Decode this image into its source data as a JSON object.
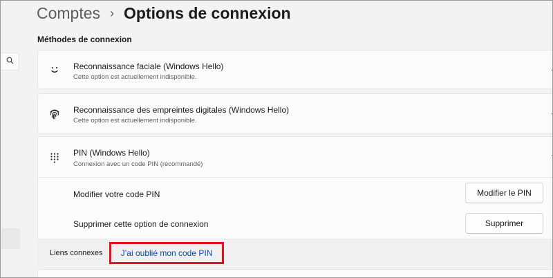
{
  "breadcrumb": {
    "parent": "Comptes",
    "separator": "›",
    "current": "Options de connexion"
  },
  "section_title": "Méthodes de connexion",
  "methods": [
    {
      "icon": "face-smile-icon",
      "title": "Reconnaissance faciale (Windows Hello)",
      "subtitle": "Cette option est actuellement indisponible."
    },
    {
      "icon": "fingerprint-icon",
      "title": "Reconnaissance des empreintes digitales (Windows Hello)",
      "subtitle": "Cette option est actuellement indisponible."
    },
    {
      "icon": "pin-keypad-icon",
      "title": "PIN (Windows Hello)",
      "subtitle": "Connexion avec un code PIN (recommandé)"
    }
  ],
  "pin_options": {
    "change_label": "Modifier votre code PIN",
    "change_button": "Modifier le PIN",
    "remove_label": "Supprimer cette option de connexion",
    "remove_button": "Supprimer"
  },
  "related": {
    "label": "Liens connexes",
    "link": "J’ai oublié mon code PIN"
  },
  "colors": {
    "highlight": "#e5101d",
    "link": "#0a4aa8"
  }
}
